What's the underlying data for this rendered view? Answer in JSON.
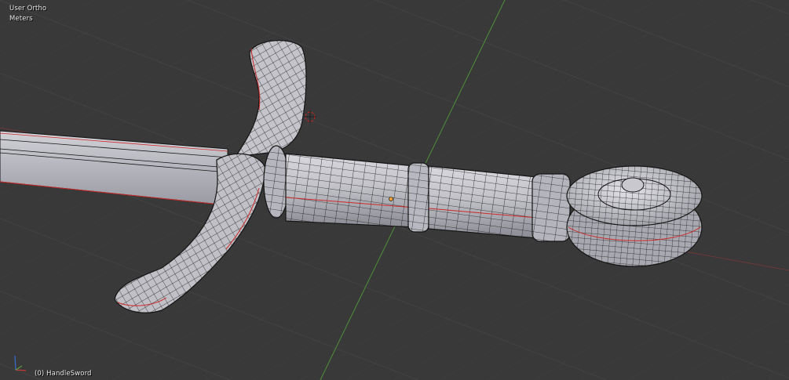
{
  "viewport": {
    "view_name": "User Ortho",
    "units": "Meters",
    "object_info": "(0) HandleSword"
  },
  "colors": {
    "background": "#393939",
    "grid": "#444444",
    "x_axis": "#a63838",
    "y_axis": "#4f8f3a",
    "mesh_fill": "#c6c6cc",
    "mesh_shade": "#8c8c96",
    "wire": "#141414",
    "seam": "#cc2a2a",
    "origin": "#f0a030",
    "cursor": "#cc2222"
  },
  "scene": {
    "object_name": "HandleSword",
    "axis_gizmo": [
      "x-axis",
      "y-axis",
      "z-axis"
    ]
  }
}
